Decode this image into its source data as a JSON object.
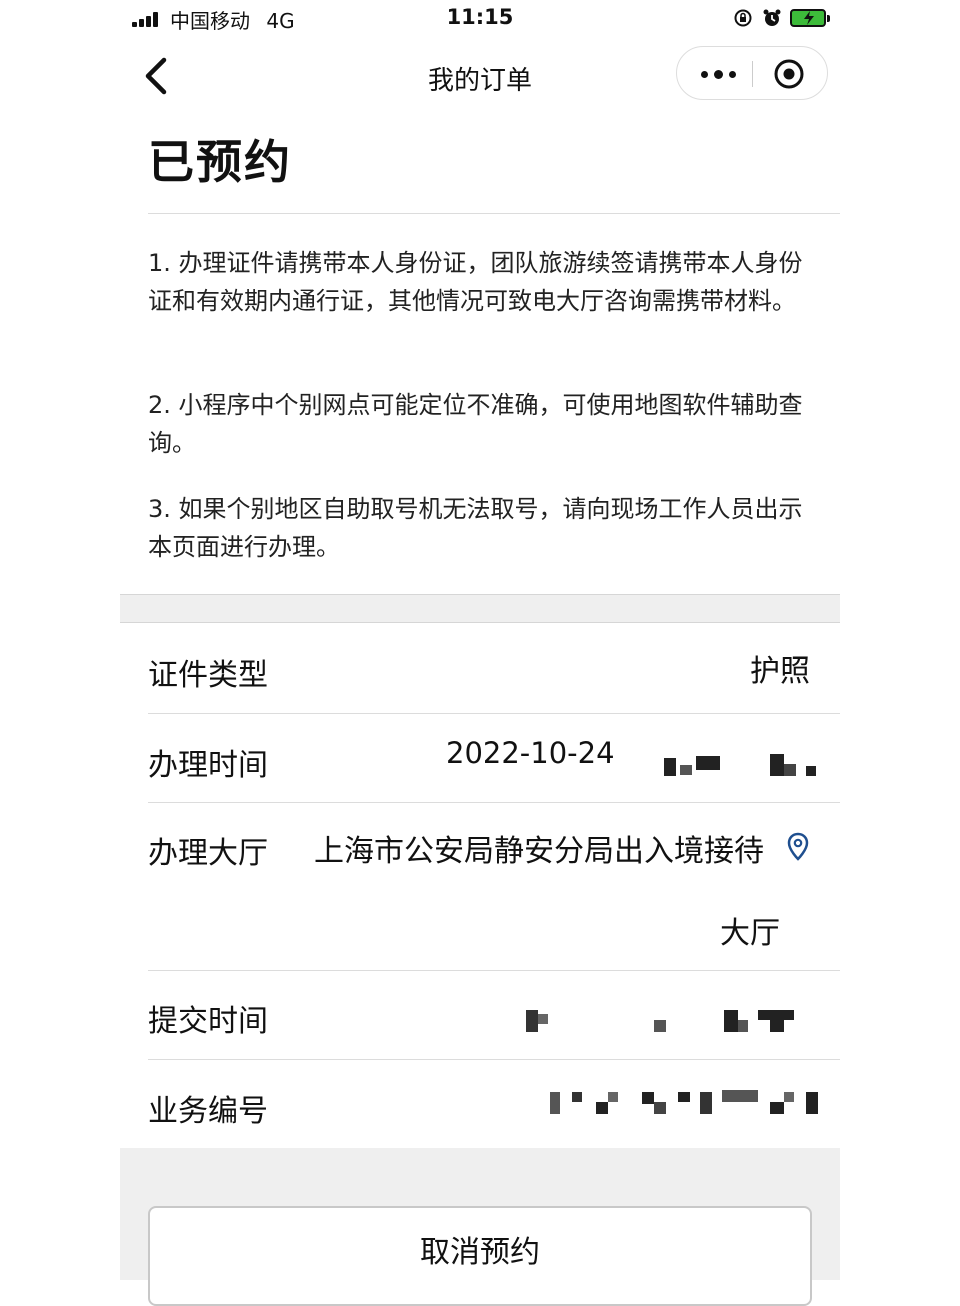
{
  "status_bar": {
    "carrier": "中国移动",
    "network": "4G",
    "time": "11:15"
  },
  "nav": {
    "title": "我的订单",
    "icons": [
      "back-arrow-icon",
      "more-dots-icon",
      "close-target-icon"
    ]
  },
  "page": {
    "status_title": "已预约"
  },
  "notices": [
    "1. 办理证件请携带本人身份证，团队旅游续签请携带本人身份证和有效期内通行证，其他情况可致电大厅咨询需携带材料。",
    "2. 小程序中个别网点可能定位不准确，可使用地图软件辅助查询。",
    "3. 如果个别地区自助取号机无法取号，请向现场工作人员出示本页面进行办理。"
  ],
  "details": {
    "doc_type": {
      "label": "证件类型",
      "value": "护照"
    },
    "appointment_time": {
      "label": "办理时间",
      "value": "2022-10-24"
    },
    "hall": {
      "label": "办理大厅",
      "value_line1": "上海市公安局静安分局出入境接待",
      "value_line2": "大厅"
    },
    "submit_time": {
      "label": "提交时间"
    },
    "business_no": {
      "label": "业务编号"
    }
  },
  "actions": {
    "cancel_label": "取消预约"
  },
  "colors": {
    "background": "#ffffff",
    "section_gray": "#efefef",
    "battery_green": "#3dbb3a",
    "location_icon": "#1f4f8f"
  }
}
